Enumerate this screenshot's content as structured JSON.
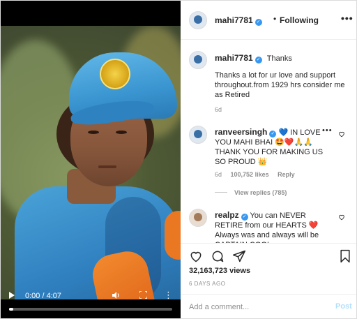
{
  "video": {
    "time": "0:00 / 4:07",
    "progress": 0.0
  },
  "header": {
    "username": "mahi7781",
    "separator": "•",
    "follow_label": "Following",
    "more": "•••"
  },
  "caption": {
    "username": "mahi7781",
    "title": "Thanks",
    "body": "Thanks a lot for ur love and support throughout.from 1929 hrs consider me as Retired",
    "age": "6d"
  },
  "comments": [
    {
      "username": "ranveersingh",
      "text": "💙 IN LOVE YOU MAHI BHAI 🤩❤️🙏🙏 THANK YOU FOR MAKING US SO PROUD 👑",
      "age": "6d",
      "likes": "100,752 likes",
      "reply_label": "Reply",
      "view_replies": "View replies (785)"
    },
    {
      "username": "realpz",
      "text": "You can NEVER RETIRE from our HEARTS ❤️ Always was and always will be CAPTAIN COOL"
    }
  ],
  "actions": {
    "views": "32,163,723 views",
    "date": "6 DAYS AGO",
    "comment_placeholder": "Add a comment...",
    "post_label": "Post"
  },
  "colors": {
    "verified": "#3897f0",
    "post_disabled": "#b2dffc",
    "heart_red": "#ed4956"
  }
}
